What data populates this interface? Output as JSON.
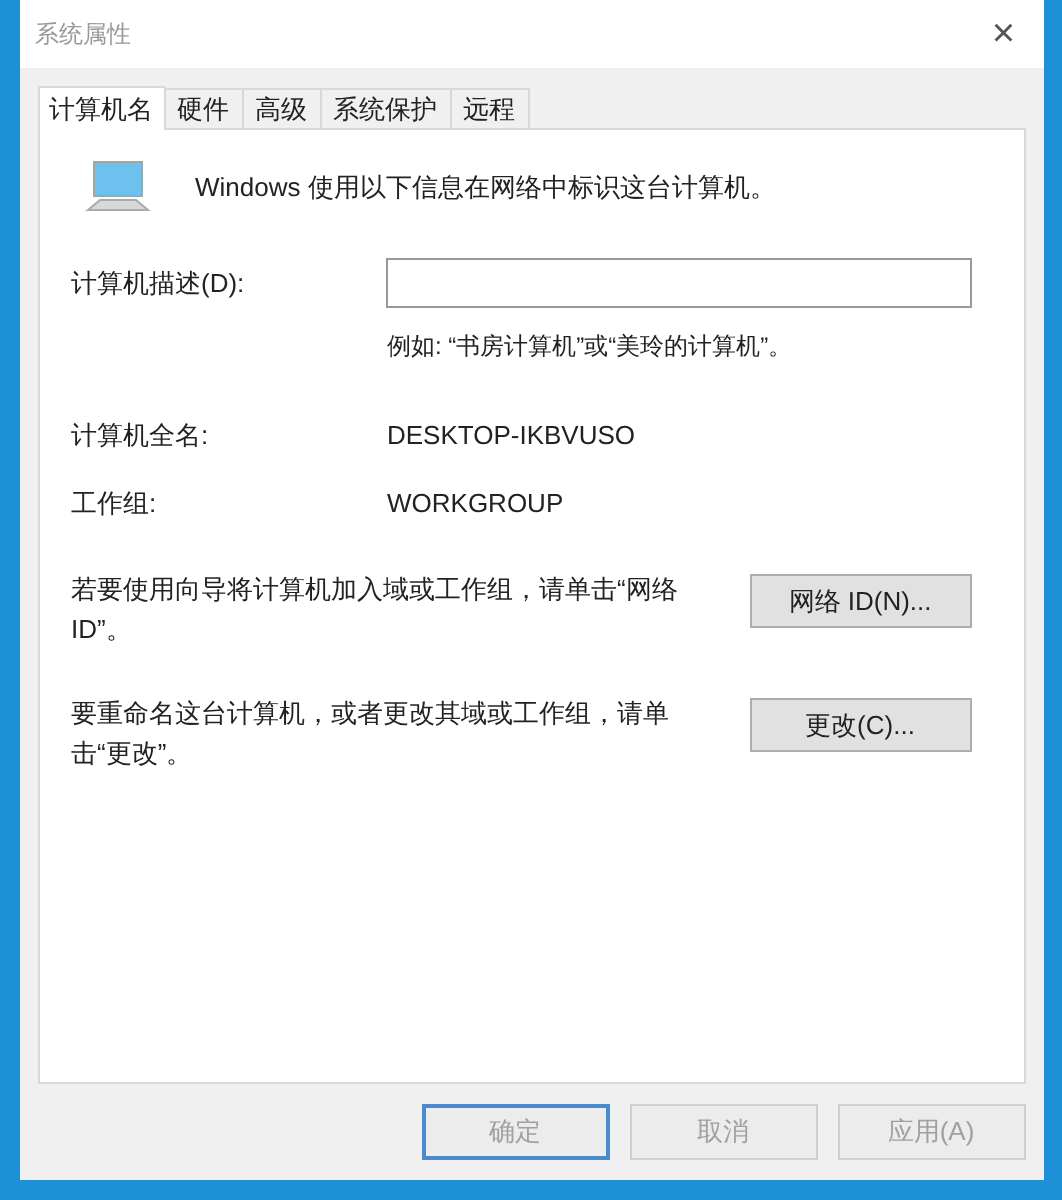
{
  "window": {
    "title": "系统属性",
    "close": "×"
  },
  "tabs": [
    {
      "label": "计算机名",
      "selected": true
    },
    {
      "label": "硬件",
      "selected": false
    },
    {
      "label": "高级",
      "selected": false
    },
    {
      "label": "系统保护",
      "selected": false
    },
    {
      "label": "远程",
      "selected": false
    }
  ],
  "intro": "Windows 使用以下信息在网络中标识这台计算机。",
  "description": {
    "label": "计算机描述(D):",
    "hint": "例如: “书房计算机”或“美玲的计算机”。"
  },
  "info": [
    {
      "label": "计算机全名:",
      "value": "DESKTOP-IKBVUSO"
    },
    {
      "label": "工作组:",
      "value": "WORKGROUP"
    }
  ],
  "actions": [
    {
      "text": "若要使用向导将计算机加入域或工作组，请单击“网络 ID”。",
      "button": "网络 ID(N)..."
    },
    {
      "text": "要重命名这台计算机，或者更改其域或工作组，请单击“更改”。",
      "button": "更改(C)..."
    }
  ],
  "buttons": [
    {
      "label": "确定",
      "default": true,
      "disabled": true
    },
    {
      "label": "取消",
      "default": false,
      "disabled": true
    },
    {
      "label": "应用(A)",
      "default": false,
      "disabled": true
    }
  ]
}
